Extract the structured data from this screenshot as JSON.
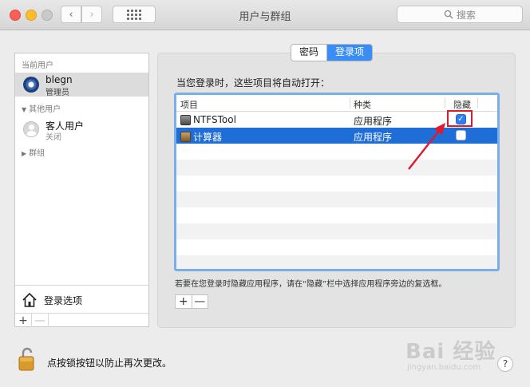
{
  "window": {
    "title": "用户与群组",
    "search_placeholder": "搜索"
  },
  "sidebar": {
    "current_users_header": "当前用户",
    "current_user": {
      "name": "blegn",
      "role": "管理员"
    },
    "other_users_header": "其他用户",
    "guest_user": {
      "name": "客人用户",
      "status": "关闭"
    },
    "groups_header": "群组",
    "login_options": "登录选项",
    "add": "+",
    "remove": "—"
  },
  "tabs": [
    {
      "label": "密码",
      "active": false
    },
    {
      "label": "登录项",
      "active": true
    }
  ],
  "login_items": {
    "heading": "当您登录时，这些项目将自动打开：",
    "columns": {
      "item": "项目",
      "kind": "种类",
      "hide": "隐藏"
    },
    "rows": [
      {
        "name": "NTFSTool",
        "kind": "应用程序",
        "hidden": true,
        "icon": "ntfstool-icon"
      },
      {
        "name": "计算器",
        "kind": "应用程序",
        "hidden": false,
        "icon": "calculator-icon"
      }
    ],
    "hint": "若要在您登录时隐藏应用程序，请在“隐藏”栏中选择应用程序旁边的复选框。",
    "add": "+",
    "remove": "—"
  },
  "footer": {
    "lock_text": "点按锁按钮以防止再次更改。",
    "help": "?"
  },
  "watermark": {
    "main": "Bai 经验",
    "sub": "jingyan.baidu.com"
  },
  "colors": {
    "accent": "#3a8df4",
    "selection": "#1f6dd6",
    "annotation": "#e0192c"
  }
}
